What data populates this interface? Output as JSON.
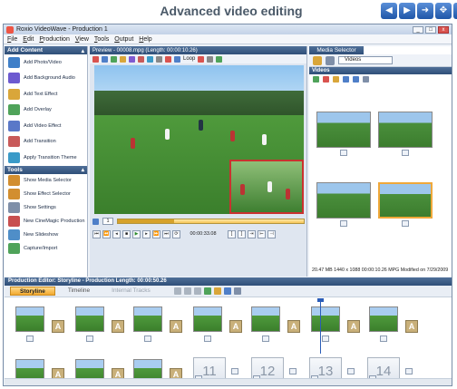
{
  "banner": {
    "title": "Advanced video editing",
    "nav": [
      "back-icon",
      "play-icon",
      "forward-icon",
      "move-icon",
      "close-icon"
    ]
  },
  "window": {
    "title": "Roxio VideoWave - Production 1",
    "controls": [
      "_",
      "□",
      "x"
    ]
  },
  "menu": [
    "File",
    "Edit",
    "Production",
    "View",
    "Tools",
    "Output",
    "Help"
  ],
  "add_content": {
    "title": "Add Content",
    "items": [
      {
        "label": "Add Photo/Video",
        "color": "#3f7fc8"
      },
      {
        "label": "Add Background Audio",
        "color": "#6c5ad0"
      },
      {
        "label": "Add Text Effect",
        "color": "#d9a63a"
      },
      {
        "label": "Add Overlay",
        "color": "#4fa35a"
      },
      {
        "label": "Add Video Effect",
        "color": "#5a78c8"
      },
      {
        "label": "Add Transition",
        "color": "#c85a5a"
      },
      {
        "label": "Apply Transition Theme",
        "color": "#3a9ac8"
      }
    ]
  },
  "tools": {
    "title": "Tools",
    "items": [
      {
        "label": "Show Media Selector",
        "color": "#d28e2f"
      },
      {
        "label": "Show Effect Selector",
        "color": "#d28e2f"
      },
      {
        "label": "Show Settings",
        "color": "#7f8fa8"
      },
      {
        "label": "New CineMagic Production",
        "color": "#c84f4f"
      },
      {
        "label": "New Slideshow",
        "color": "#4f8ec8"
      },
      {
        "label": "Capture/Import",
        "color": "#4fa35a"
      }
    ]
  },
  "preview": {
    "title": "Preview - 00008.mpg (Length: 00:00:10.26)",
    "loop_label": "Loop",
    "frame_value": "1",
    "timecode": "00:00:33.08",
    "progress": 0.3
  },
  "media_selector": {
    "tab": "Media Selector",
    "source": "Videos",
    "section": "Videos",
    "status": "20.47 MB   1440 x 1088 00:00:10.26 MPG  Modified on 7/29/2009"
  },
  "timeline": {
    "title": "Production Editor: Storyline - Production Length: 00:00:50.26",
    "tabs": [
      "Storyline",
      "Timeline",
      "Internal Tracks"
    ],
    "empty_slots": [
      "11",
      "12",
      "13",
      "14"
    ]
  }
}
